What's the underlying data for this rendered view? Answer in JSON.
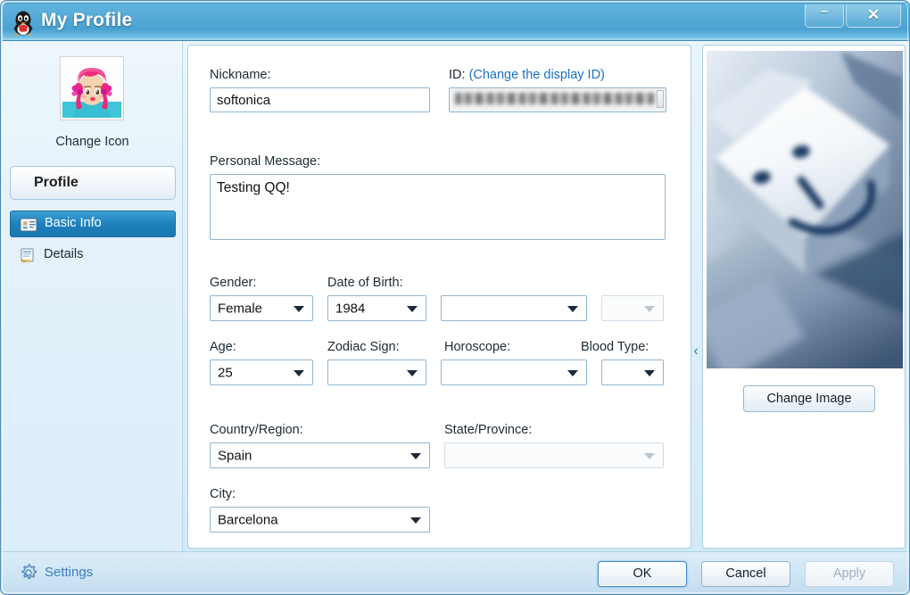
{
  "window": {
    "title": "My Profile",
    "app_icon": "qq-penguin-icon",
    "minimize_label": "–",
    "close_label": "✕"
  },
  "sidebar": {
    "avatar_icon": "user-avatar-anime-girl",
    "change_icon_label": "Change Icon",
    "profile_tab_label": "Profile",
    "items": [
      {
        "label": "Basic Info",
        "icon": "id-card-icon",
        "selected": true
      },
      {
        "label": "Details",
        "icon": "document-details-icon",
        "selected": false
      }
    ]
  },
  "form": {
    "nickname": {
      "label": "Nickname:",
      "value": "softonica",
      "placeholder": ""
    },
    "id": {
      "label": "ID:",
      "change_link": "(Change the display ID)",
      "value": "",
      "redacted": true
    },
    "personal_message": {
      "label": "Personal Message:",
      "value": "Testing QQ!",
      "placeholder": ""
    },
    "gender": {
      "label": "Gender:",
      "value": "Female"
    },
    "date_of_birth": {
      "label": "Date of Birth:",
      "year": "1984",
      "month": "",
      "day": ""
    },
    "age": {
      "label": "Age:",
      "value": "25"
    },
    "zodiac_sign": {
      "label": "Zodiac Sign:",
      "value": ""
    },
    "horoscope": {
      "label": "Horoscope:",
      "value": ""
    },
    "blood_type": {
      "label": "Blood Type:",
      "value": ""
    },
    "country_region": {
      "label": "Country/Region:",
      "value": "Spain"
    },
    "state_province": {
      "label": "State/Province:",
      "value": ""
    },
    "city": {
      "label": "City:",
      "value": "Barcelona"
    }
  },
  "right_panel": {
    "photo_icon": "keyboard-key-smiley-photo",
    "change_image_label": "Change Image",
    "collapse_icon": "chevron-left-icon",
    "collapse_label": "‹"
  },
  "footer": {
    "settings_label": "Settings",
    "settings_icon": "gear-icon",
    "ok_label": "OK",
    "cancel_label": "Cancel",
    "apply_label": "Apply"
  },
  "colors": {
    "titlebar_blue": "#4ba2d0",
    "accent_selected": "#1f81bd",
    "link_blue": "#1a72c4",
    "settings_link": "#3b7fc0",
    "panel_border": "#a9cde4",
    "field_border": "#8fb6d2"
  }
}
